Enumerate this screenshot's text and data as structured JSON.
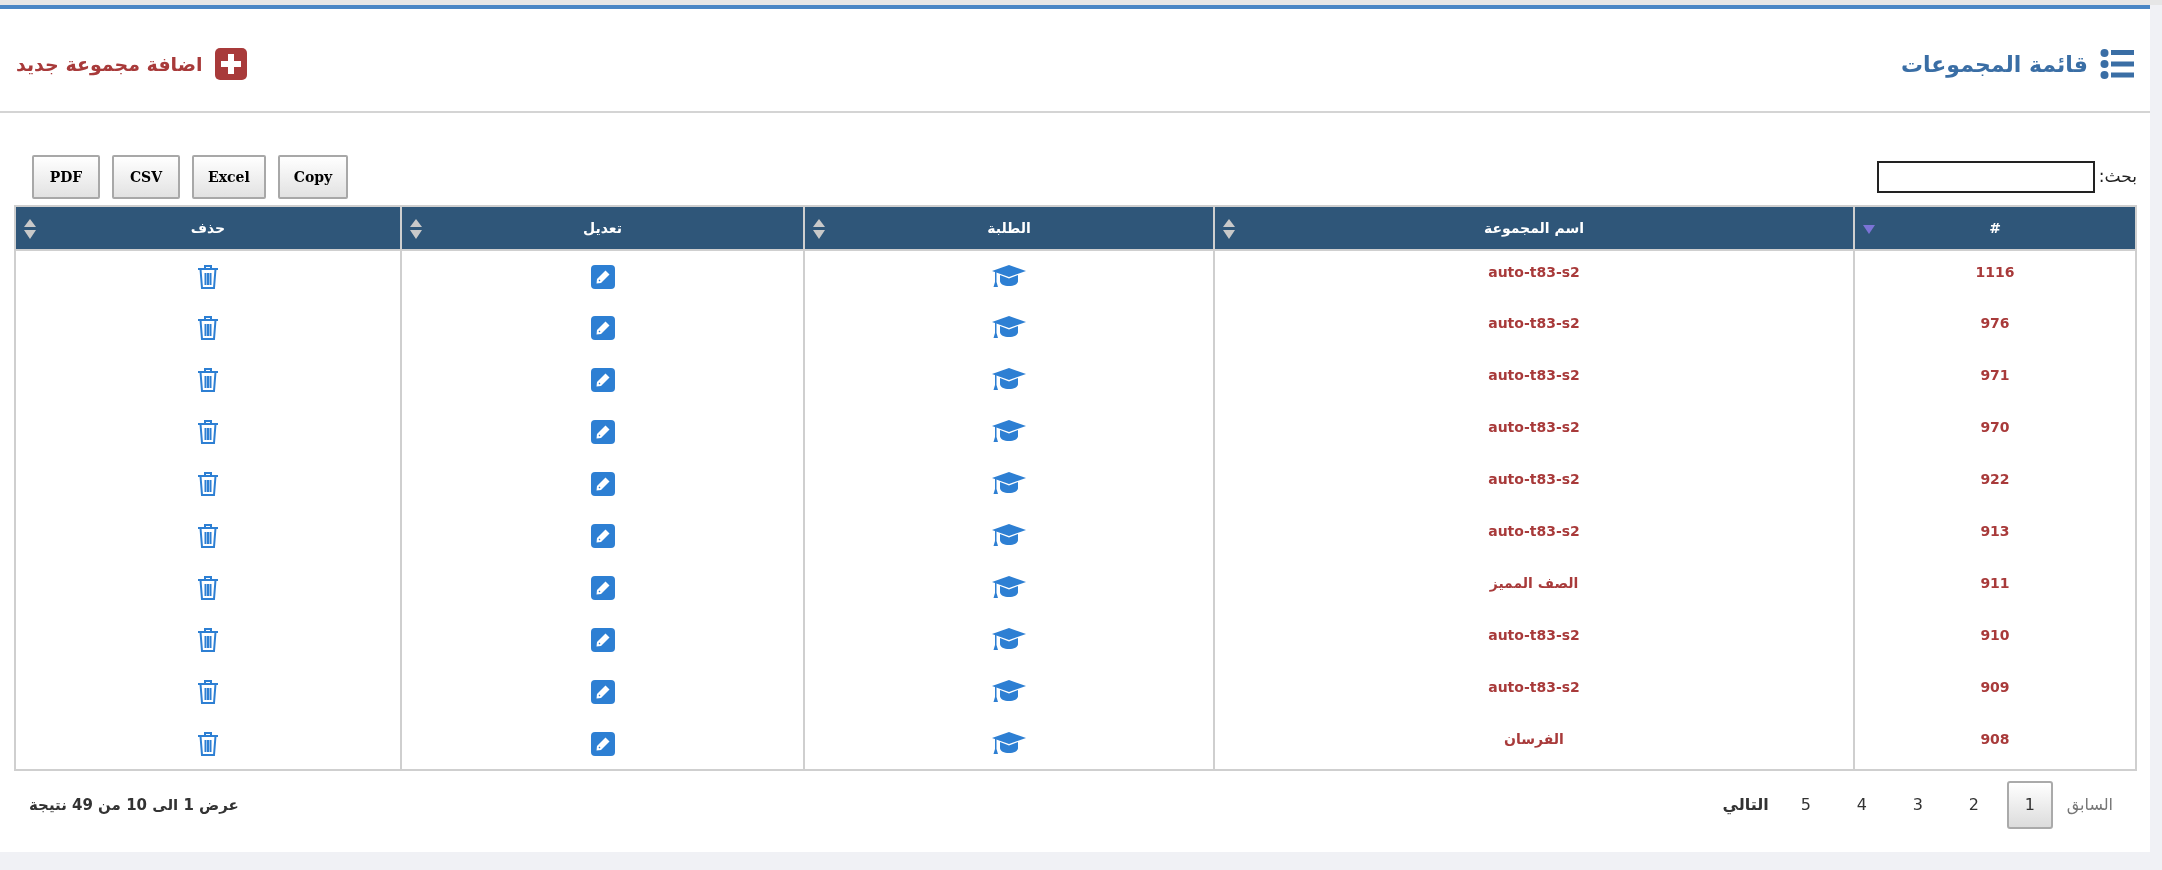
{
  "header": {
    "title": "قائمة المجموعات",
    "add_button": "اضافة مجموعة جديد"
  },
  "search": {
    "label": "بحث:"
  },
  "export_buttons": [
    "Copy",
    "Excel",
    "CSV",
    "PDF"
  ],
  "table": {
    "columns": [
      {
        "label": "#",
        "sorted": true
      },
      {
        "label": "اسم المجموعة",
        "sorted": false
      },
      {
        "label": "الطلبة",
        "sorted": false
      },
      {
        "label": "تعديل",
        "sorted": false
      },
      {
        "label": "حذف",
        "sorted": false
      }
    ],
    "rows": [
      {
        "id": "1116",
        "name": "auto-t83-s2"
      },
      {
        "id": "976",
        "name": "auto-t83-s2"
      },
      {
        "id": "971",
        "name": "auto-t83-s2"
      },
      {
        "id": "970",
        "name": "auto-t83-s2"
      },
      {
        "id": "922",
        "name": "auto-t83-s2"
      },
      {
        "id": "913",
        "name": "auto-t83-s2"
      },
      {
        "id": "911",
        "name": "الصف المميز"
      },
      {
        "id": "910",
        "name": "auto-t83-s2"
      },
      {
        "id": "909",
        "name": "auto-t83-s2"
      },
      {
        "id": "908",
        "name": "الفرسان"
      }
    ]
  },
  "info": "عرض 1 الى 10 من 49 نتيجة",
  "pagination": {
    "previous": {
      "label": "السابق",
      "disabled": true
    },
    "pages": [
      {
        "label": "1",
        "selected": true
      },
      {
        "label": "2",
        "selected": false
      },
      {
        "label": "3",
        "selected": false
      },
      {
        "label": "4",
        "selected": false
      },
      {
        "label": "5",
        "selected": false
      }
    ],
    "next": {
      "label": "التالي",
      "disabled": false
    }
  }
}
